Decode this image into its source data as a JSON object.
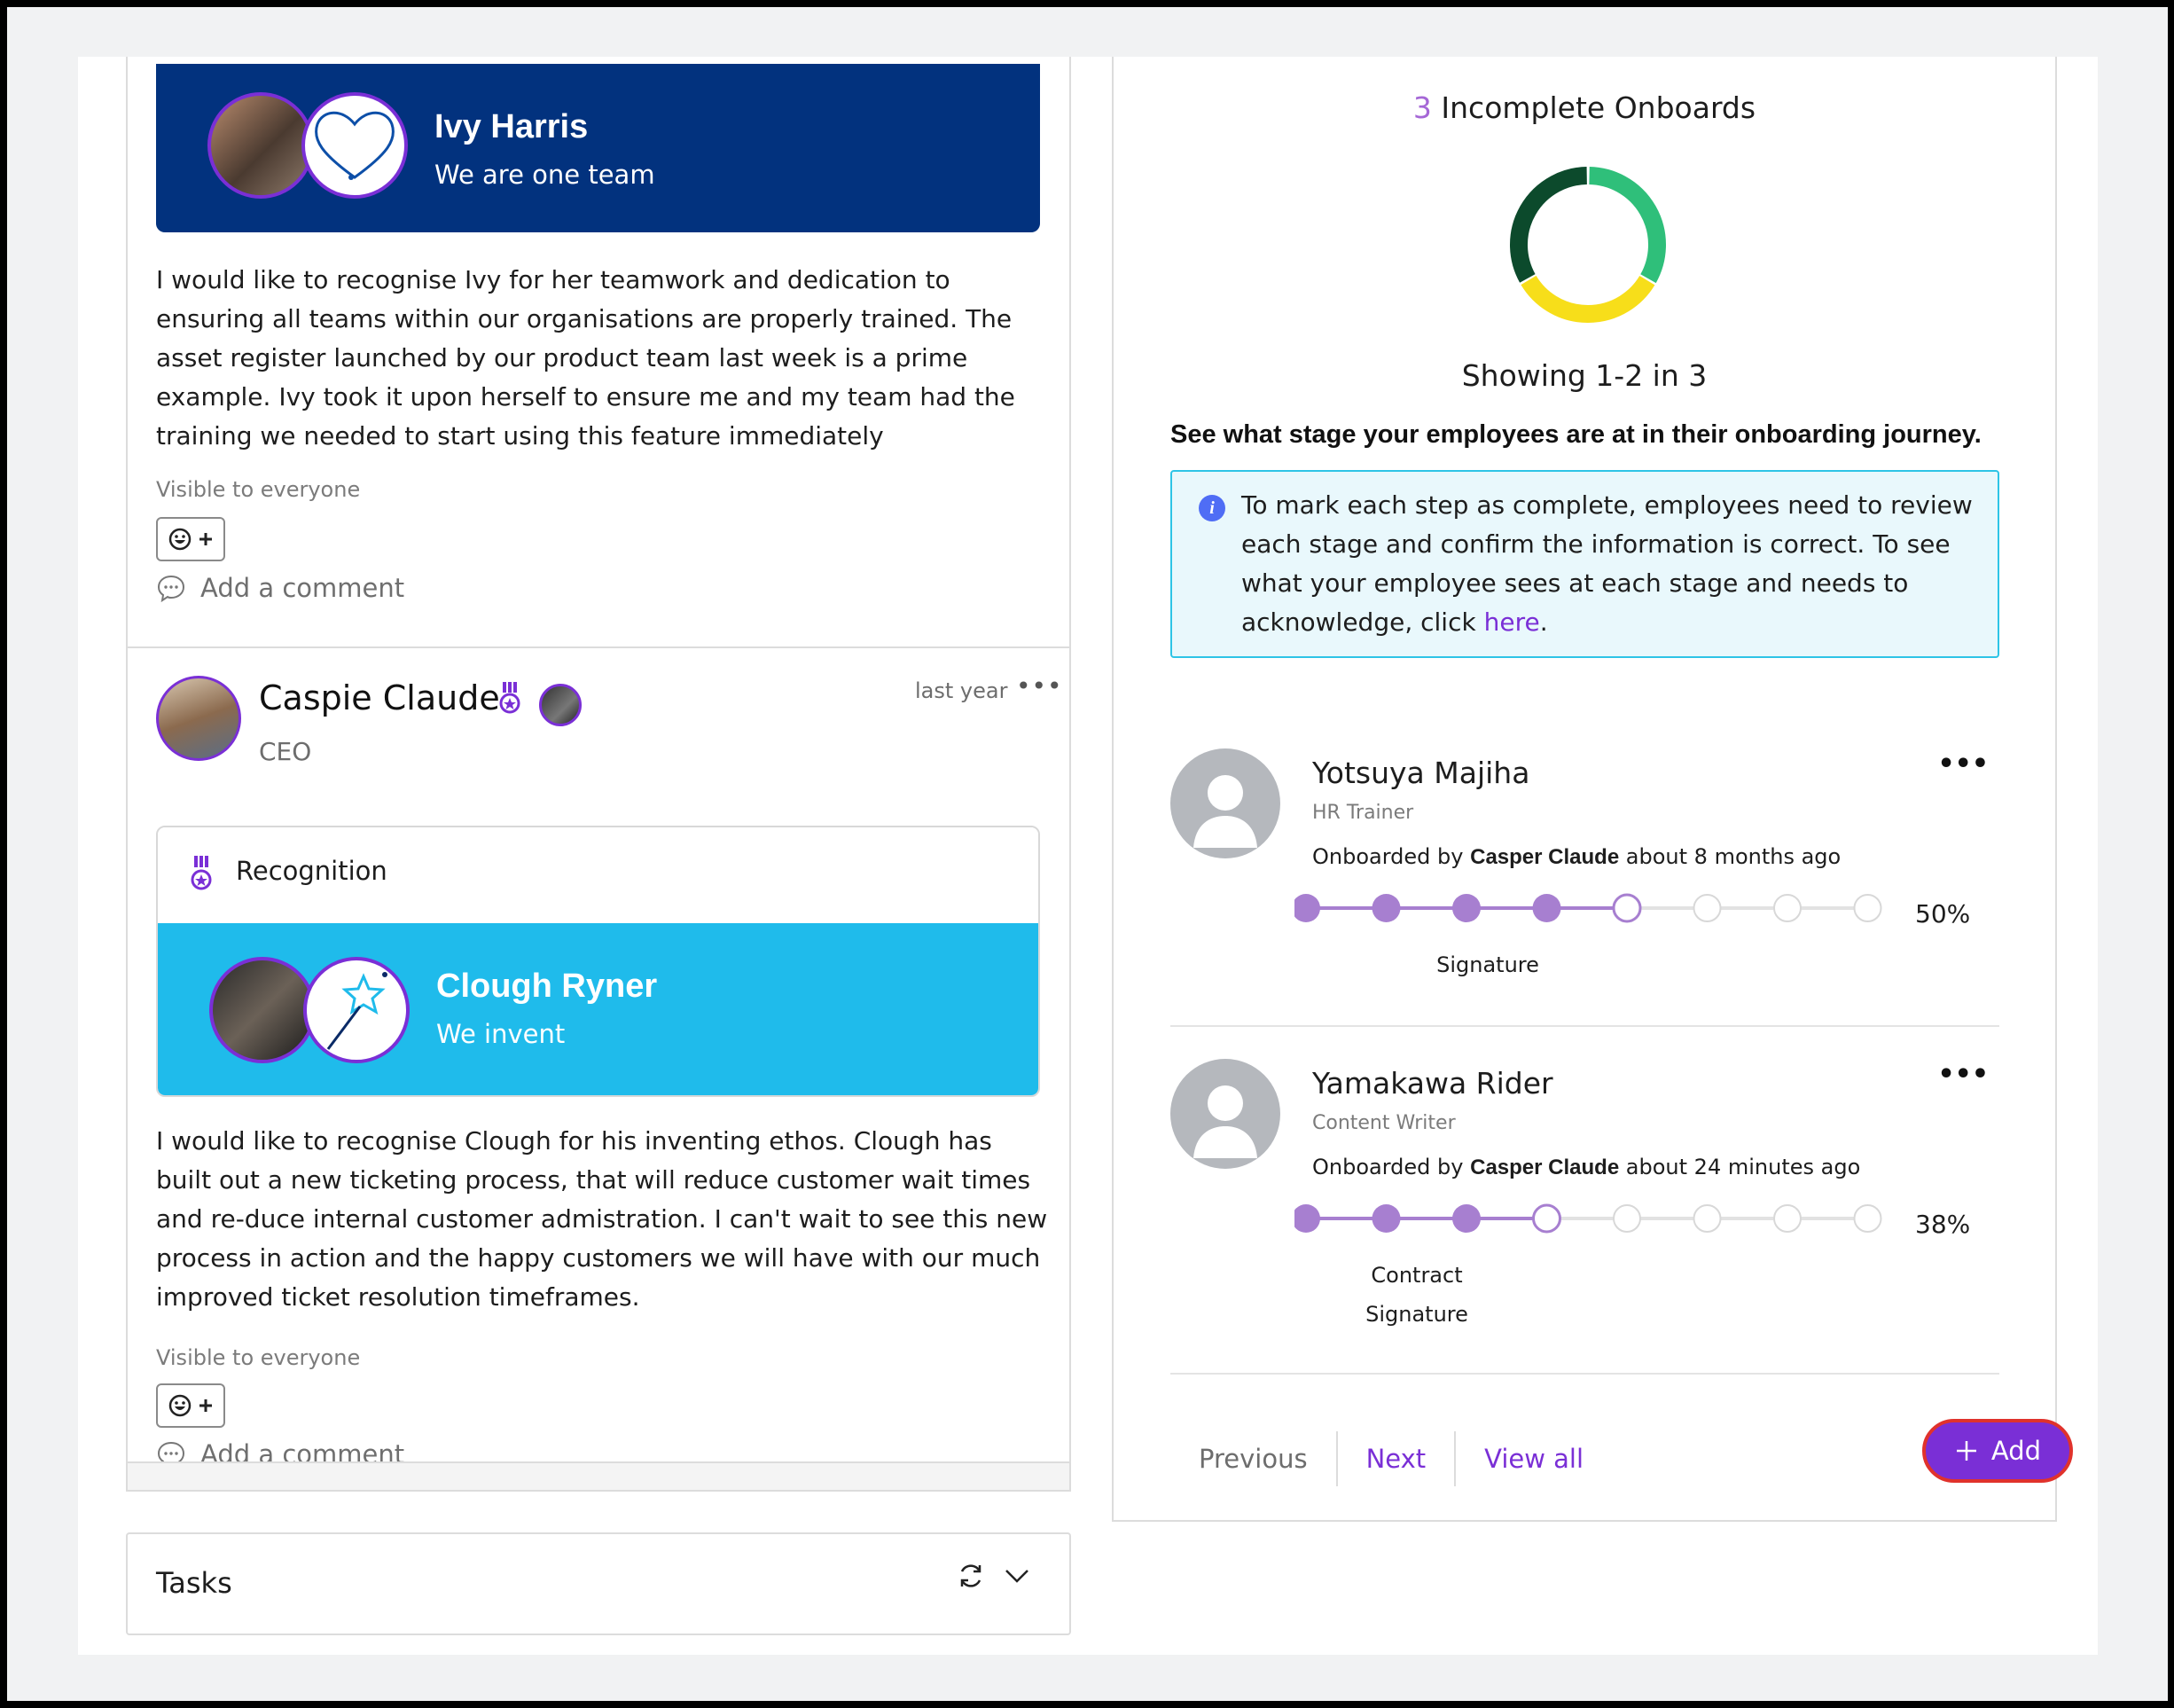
{
  "feed": {
    "post1": {
      "banner_name": "Ivy Harris",
      "banner_value": "We are one team",
      "text": "I would like to recognise Ivy for her teamwork and dedication to ensuring all teams within our organisations are properly trained. The asset register launched by our product team last week is a prime example. Ivy took it upon herself to ensure me and my team had the training we needed to start using this feature immediately",
      "visibility": "Visible to everyone",
      "comment_placeholder": "Add a comment"
    },
    "post2": {
      "author": "Caspie Claude",
      "role": "CEO",
      "time": "last year",
      "recognition_label": "Recognition",
      "banner_name": "Clough Ryner",
      "banner_value": "We invent",
      "text": "I would like to recognise Clough for his inventing ethos. Clough has built out a new ticketing process, that will reduce customer wait times and re-duce internal customer admistration. I can't wait to see this new process in action and the happy customers we will have with our much improved ticket resolution timeframes.",
      "visibility": "Visible to everyone",
      "comment_placeholder": "Add a comment"
    }
  },
  "tasks": {
    "title": "Tasks"
  },
  "onboarding": {
    "count": "3",
    "title_suffix": " Incomplete Onboards",
    "showing": "Showing 1-2 in 3",
    "stage_heading": "See what stage your employees are at in their onboarding journey.",
    "info_text": "To mark each step as complete, employees need to review each stage and confirm the information is correct. To see what your employee sees at each stage and needs to acknowledge, click ",
    "info_link": "here",
    "info_end": ".",
    "donut": [
      {
        "label": "segment-1",
        "fraction": 0.333,
        "color": "#2fbf7a"
      },
      {
        "label": "segment-2",
        "fraction": 0.333,
        "color": "#f7de1a"
      },
      {
        "label": "segment-3",
        "fraction": 0.333,
        "color": "#0c4a2c"
      }
    ],
    "people": [
      {
        "name": "Yotsuya Majiha",
        "role": "HR Trainer",
        "onboarded_prefix": "Onboarded by ",
        "onboarded_by": "Casper Claude",
        "onboarded_time": " about 8 months ago",
        "steps_total": 8,
        "steps_done": 4,
        "current_step": 5,
        "percent": "50%",
        "stage_label": "Signature"
      },
      {
        "name": "Yamakawa Rider",
        "role": "Content Writer",
        "onboarded_prefix": "Onboarded by ",
        "onboarded_by": "Casper Claude",
        "onboarded_time": " about 24 minutes ago",
        "steps_total": 8,
        "steps_done": 3,
        "current_step": 4,
        "percent": "38%",
        "stage_label_line1": "Contract",
        "stage_label_line2": "Signature"
      }
    ],
    "pager": {
      "previous": "Previous",
      "next": "Next",
      "view_all": "View all"
    },
    "add_label": "Add",
    "accent": "#7a2fd6",
    "step_done_color": "#a77fd0"
  }
}
